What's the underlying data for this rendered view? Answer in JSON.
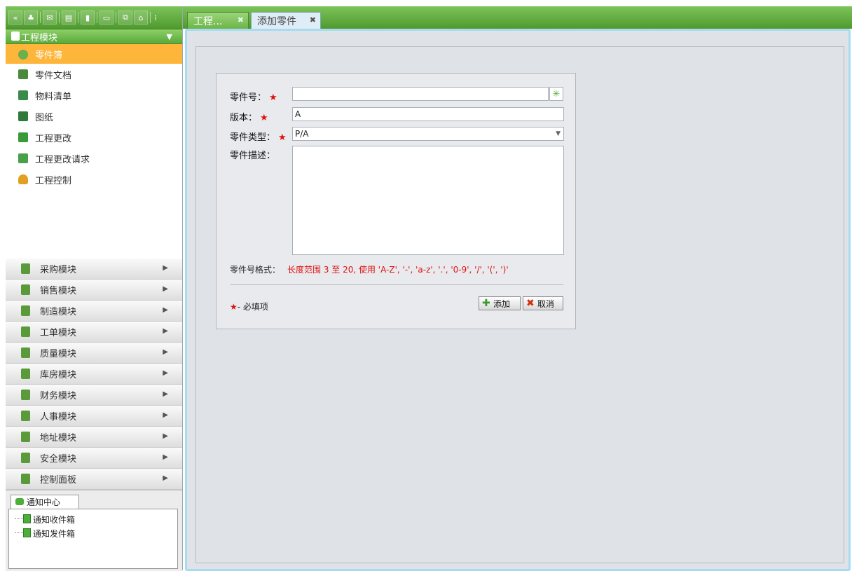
{
  "toolbar": {
    "icons": [
      "collapse-icon",
      "users-icon",
      "mail-icon",
      "document-icon",
      "chart-icon",
      "monitor-icon",
      "network-icon",
      "home-icon",
      "grip-icon"
    ]
  },
  "sidebar": {
    "active_module": "工程模块",
    "sub_items": [
      "零件簿",
      "零件文档",
      "物料清单",
      "图纸",
      "工程更改",
      "工程更改请求",
      "工程控制"
    ],
    "modules": [
      "采购模块",
      "销售模块",
      "制造模块",
      "工单模块",
      "质量模块",
      "库房模块",
      "财务模块",
      "人事模块",
      "地址模块",
      "安全模块",
      "控制面板"
    ]
  },
  "notify": {
    "tab": "通知中心",
    "items": [
      "通知收件箱",
      "通知发件箱"
    ]
  },
  "tabs": [
    {
      "label": "工程..."
    },
    {
      "label": "添加零件"
    }
  ],
  "form": {
    "part_no_label": "零件号：",
    "part_no_value": "",
    "version_label": "版本：",
    "version_value": "A",
    "type_label": "零件类型：",
    "type_value": "P/A",
    "desc_label": "零件描述：",
    "desc_value": "",
    "format_label": "零件号格式：",
    "format_value": "长度范围 3 至 20, 使用 'A-Z', '-', 'a-z', '.', '0-9', '/', '(', ')'",
    "required_note": "- 必填项",
    "add_label": "添加",
    "cancel_label": "取消",
    "required_mark": "★"
  },
  "colors": {
    "accent": "#5aa83a",
    "active_item": "#fdb53a",
    "required": "#e01010"
  }
}
